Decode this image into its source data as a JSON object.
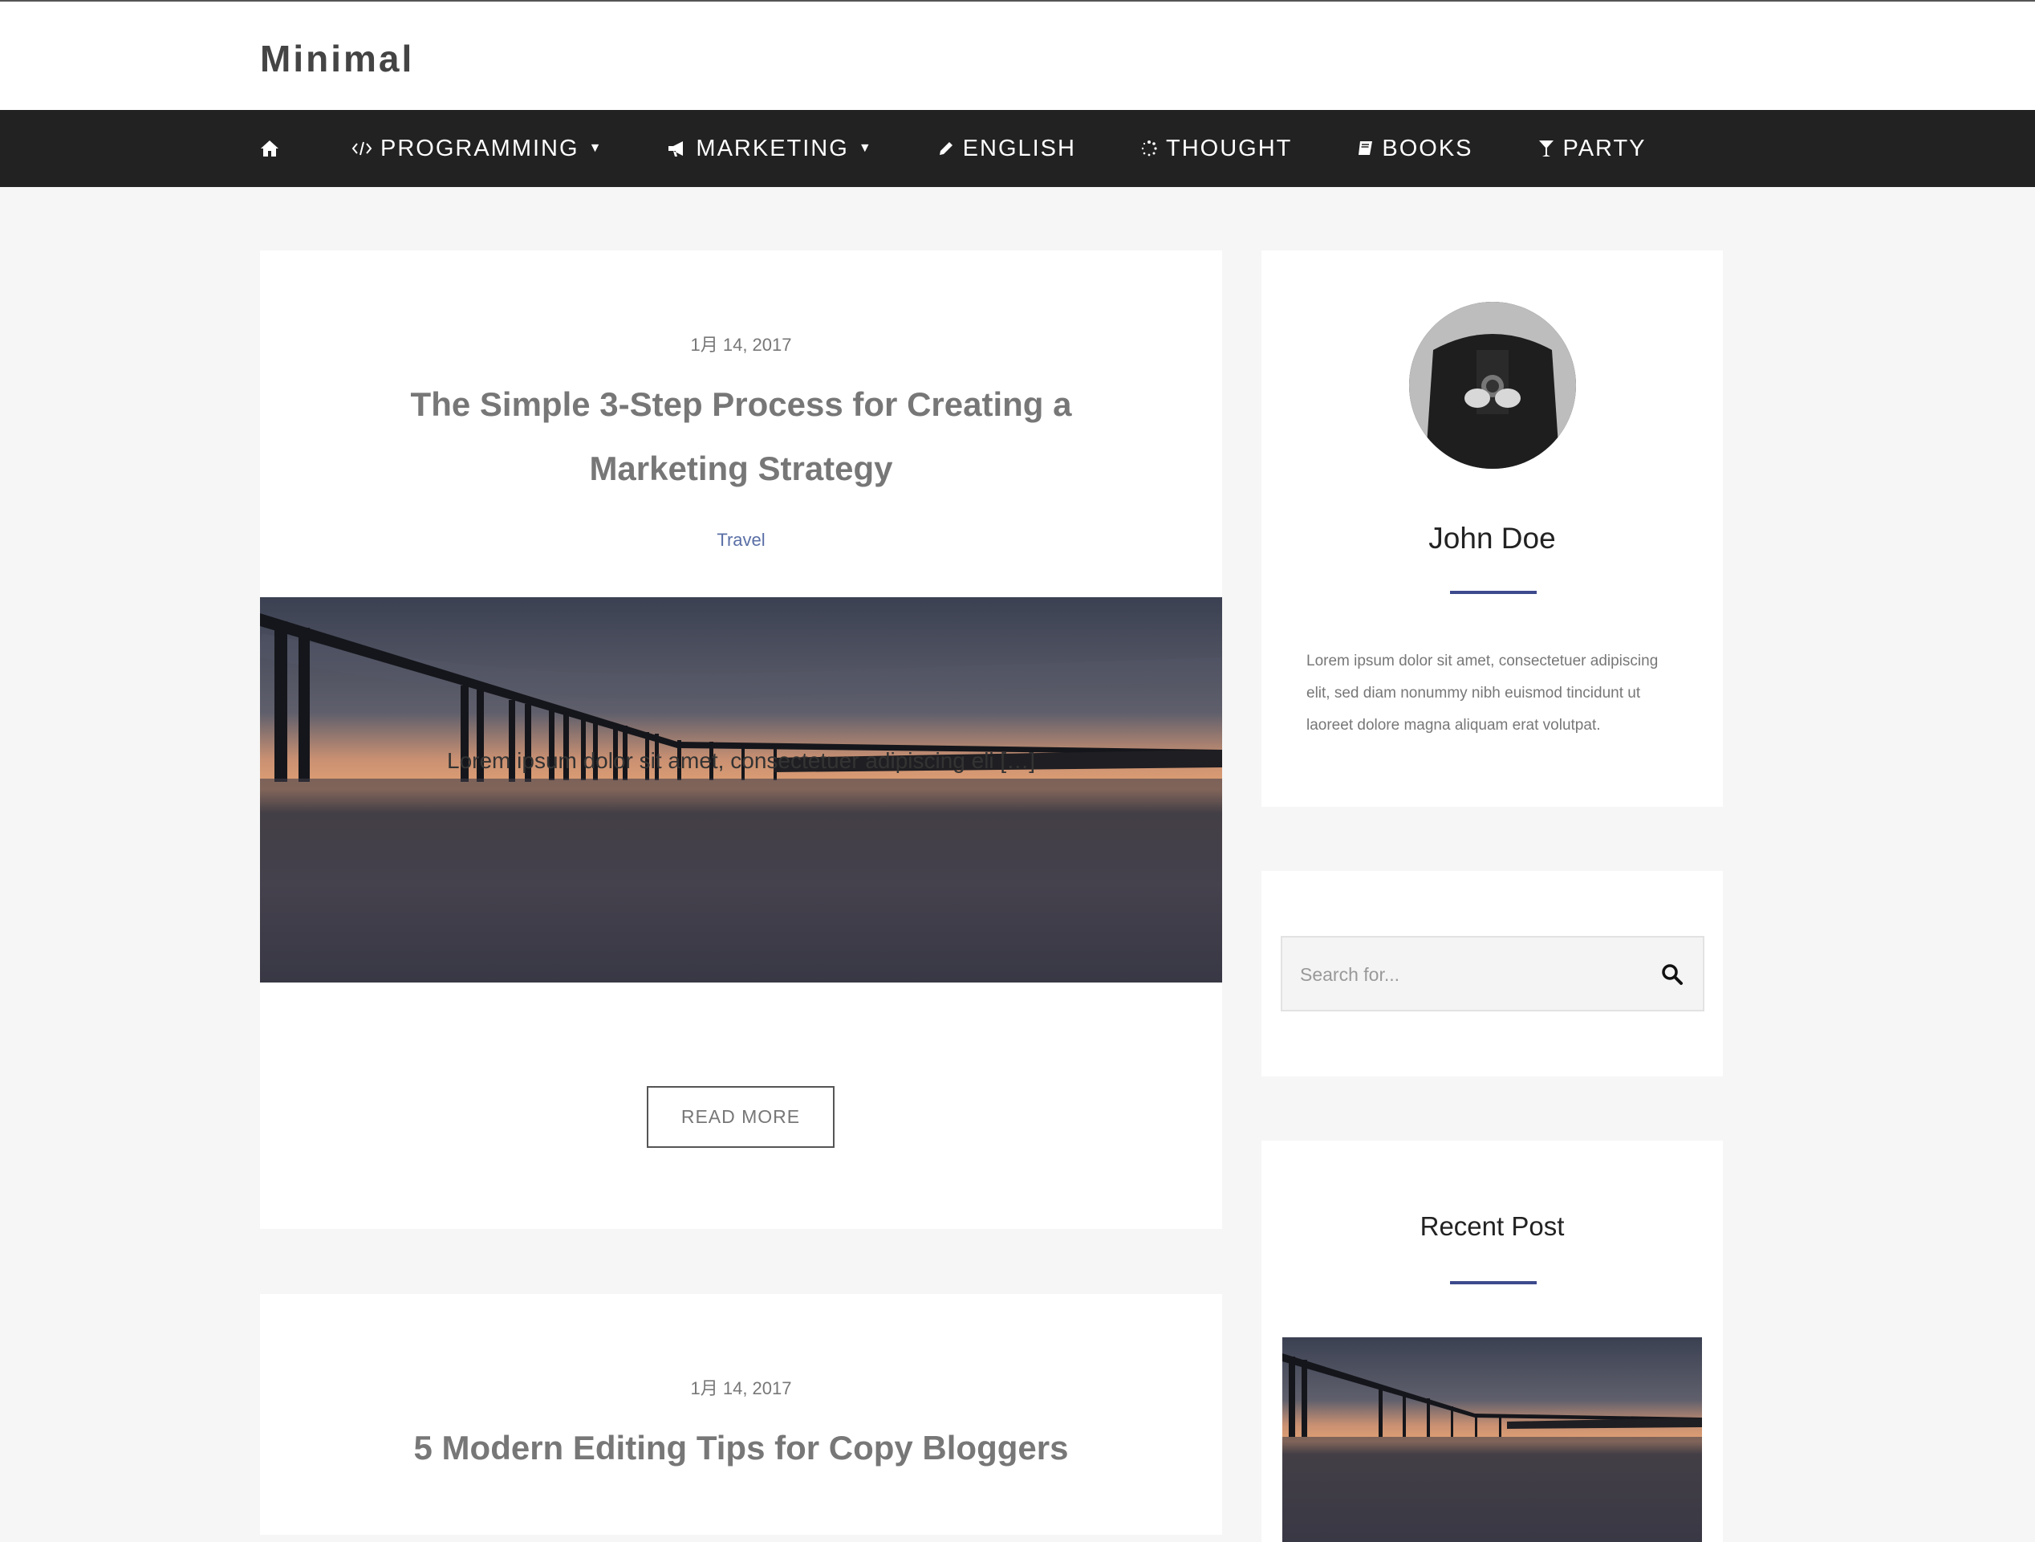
{
  "site": {
    "title": "Minimal"
  },
  "nav": {
    "items": [
      {
        "label": "PROGRAMMING",
        "icon": "code-icon",
        "dropdown": true
      },
      {
        "label": "MARKETING",
        "icon": "bullhorn-icon",
        "dropdown": true
      },
      {
        "label": "ENGLISH",
        "icon": "pencil-icon",
        "dropdown": false
      },
      {
        "label": "THOUGHT",
        "icon": "spinner-icon",
        "dropdown": false
      },
      {
        "label": "BOOKS",
        "icon": "book-icon",
        "dropdown": false
      },
      {
        "label": "PARTY",
        "icon": "cocktail-icon",
        "dropdown": false
      }
    ]
  },
  "posts": [
    {
      "date": "1月 14, 2017",
      "title": "The Simple 3-Step Process for Creating a Marketing Strategy",
      "category": "Travel",
      "excerpt": "Lorem ipsum dolor sit amet, consectetuer adipiscing eli […]",
      "read_more": "READ MORE"
    },
    {
      "date": "1月 14, 2017",
      "title": "5 Modern Editing Tips for Copy Bloggers"
    }
  ],
  "profile": {
    "name": "John Doe",
    "bio": "Lorem ipsum dolor sit amet, consectetuer adipiscing elit, sed diam nonummy nibh euismod tincidunt ut laoreet dolore magna aliquam erat volutpat."
  },
  "search": {
    "placeholder": "Search for..."
  },
  "recent": {
    "title": "Recent Post"
  },
  "colors": {
    "nav_bg": "#222222",
    "accent": "#3d4a8c",
    "category": "#5a6fa6"
  }
}
